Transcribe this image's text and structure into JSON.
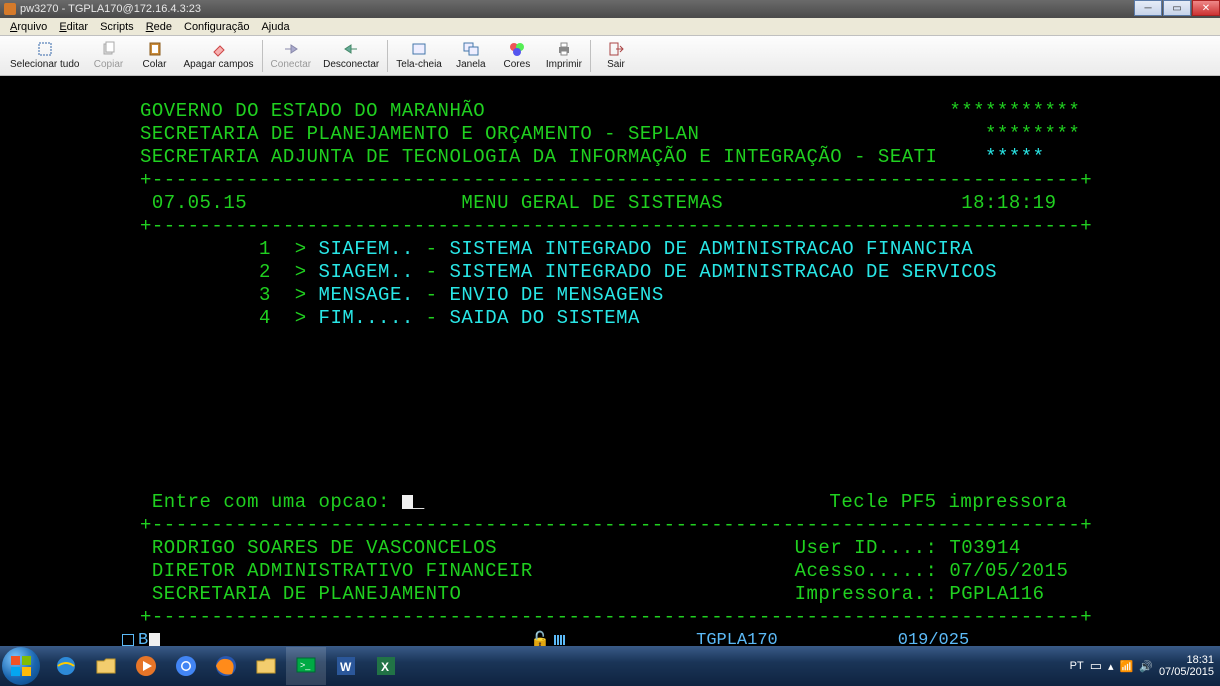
{
  "titlebar": {
    "text": "pw3270 - TGPLA170@172.16.4.3:23"
  },
  "menubar": {
    "items": [
      "Arquivo",
      "Editar",
      "Scripts",
      "Rede",
      "Configuração",
      "Ajuda"
    ]
  },
  "toolbar": {
    "select_all": "Selecionar tudo",
    "copy": "Copiar",
    "paste": "Colar",
    "clear_fields": "Apagar campos",
    "connect": "Conectar",
    "disconnect": "Desconectar",
    "fullscreen": "Tela-cheia",
    "window": "Janela",
    "colors": "Cores",
    "print": "Imprimir",
    "exit": "Sair"
  },
  "term": {
    "header1": "GOVERNO DO ESTADO DO MARANHÃO                                       ***********",
    "header2": "SECRETARIA DE PLANEJAMENTO E ORÇAMENTO - SEPLAN                        ********",
    "header3": "SECRETARIA ADJUNTA DE TECNOLOGIA DA INFORMAÇÃO E INTEGRAÇÃO - SEATI",
    "h3_stars": "    *****",
    "sep": "+------------------------------------------------------------------------------+",
    "date": " 07.05.15",
    "title": "MENU GERAL DE SISTEMAS",
    "time": "18:18:19",
    "menu": [
      {
        "n": "1",
        "code": "SIAFEM..",
        "desc": "SISTEMA INTEGRADO DE ADMINISTRACAO FINANCIRA"
      },
      {
        "n": "2",
        "code": "SIAGEM..",
        "desc": "SISTEMA INTEGRADO DE ADMINISTRACAO DE SERVICOS"
      },
      {
        "n": "3",
        "code": "MENSAGE.",
        "desc": "ENVIO DE MENSAGENS"
      },
      {
        "n": "4",
        "code": "FIM.....",
        "desc": "SAIDA DO SISTEMA"
      }
    ],
    "prompt": " Entre com uma opcao: ",
    "pf5": "Tecle PF5 impressora",
    "user_name": " RODRIGO SOARES DE VASCONCELOS",
    "user_title": " DIRETOR ADMINISTRATIVO FINANCEIR",
    "user_dept": " SECRETARIA DE PLANEJAMENTO",
    "user_id_lbl": "User ID....: ",
    "user_id": "T03914",
    "access_lbl": "Acesso.....: ",
    "access": "07/05/2015",
    "printer_lbl": "Impressora.: ",
    "printer": "PGPLA116"
  },
  "status": {
    "b": "B",
    "term_id": "TGPLA170",
    "cursor": "019/025"
  },
  "tray": {
    "lang": "PT",
    "time": "18:31",
    "date": "07/05/2015"
  }
}
